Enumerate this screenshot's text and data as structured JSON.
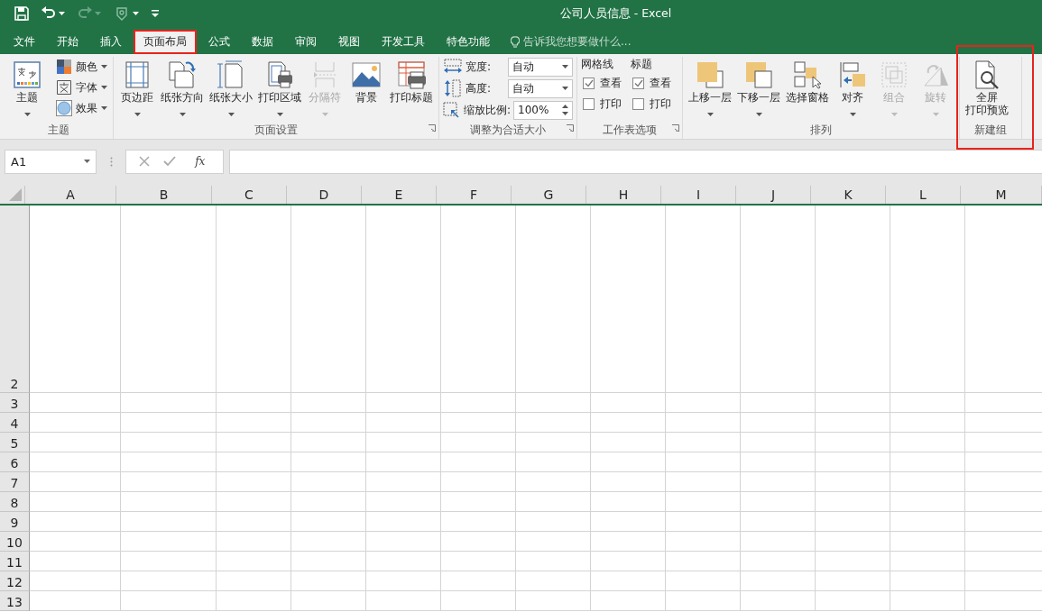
{
  "window": {
    "title": "公司人员信息 - Excel"
  },
  "quick_access": [
    {
      "kind": "save",
      "disabled": false
    },
    {
      "kind": "undo",
      "disabled": false
    },
    {
      "kind": "redo",
      "disabled": true
    },
    {
      "kind": "touch",
      "disabled": false
    },
    {
      "kind": "customize",
      "disabled": false
    }
  ],
  "tabs": [
    {
      "label": "文件",
      "selected": false,
      "highlighted": false
    },
    {
      "label": "开始",
      "selected": false,
      "highlighted": false
    },
    {
      "label": "插入",
      "selected": false,
      "highlighted": false
    },
    {
      "label": "页面布局",
      "selected": true,
      "highlighted": true
    },
    {
      "label": "公式",
      "selected": false,
      "highlighted": false
    },
    {
      "label": "数据",
      "selected": false,
      "highlighted": false
    },
    {
      "label": "审阅",
      "selected": false,
      "highlighted": false
    },
    {
      "label": "视图",
      "selected": false,
      "highlighted": false
    },
    {
      "label": "开发工具",
      "selected": false,
      "highlighted": false
    },
    {
      "label": "特色功能",
      "selected": false,
      "highlighted": false
    }
  ],
  "tell_me": {
    "placeholder": "告诉我您想要做什么..."
  },
  "ribbon": {
    "groups": [
      {
        "label": "主题",
        "launcher": false,
        "highlighted": false,
        "items": [
          {
            "kind": "large",
            "label_lines": [
              "主题"
            ],
            "dropdown": true,
            "disabled": false
          },
          {
            "kind": "stack",
            "items": [
              {
                "label": "颜色",
                "dropdown": true
              },
              {
                "label": "字体",
                "dropdown": true
              },
              {
                "label": "效果",
                "dropdown": true
              }
            ]
          }
        ]
      },
      {
        "label": "页面设置",
        "launcher": true,
        "highlighted": false,
        "items": [
          {
            "kind": "large",
            "label_lines": [
              "页边距"
            ],
            "dropdown": true,
            "disabled": false
          },
          {
            "kind": "large",
            "label_lines": [
              "纸张方向"
            ],
            "dropdown": true,
            "disabled": false
          },
          {
            "kind": "large",
            "label_lines": [
              "纸张大小"
            ],
            "dropdown": true,
            "disabled": false
          },
          {
            "kind": "large",
            "label_lines": [
              "打印区域"
            ],
            "dropdown": true,
            "disabled": false
          },
          {
            "kind": "large",
            "label_lines": [
              "分隔符"
            ],
            "dropdown": true,
            "disabled": true
          },
          {
            "kind": "large",
            "label_lines": [
              "背景"
            ],
            "dropdown": false,
            "disabled": false
          },
          {
            "kind": "large",
            "label_lines": [
              "打印标题"
            ],
            "dropdown": false,
            "disabled": false
          }
        ]
      },
      {
        "label": "调整为合适大小",
        "launcher": true,
        "highlighted": false,
        "items": [
          {
            "kind": "fields",
            "items": [
              {
                "label": "宽度:",
                "value": "自动",
                "kind": "dropdown"
              },
              {
                "label": "高度:",
                "value": "自动",
                "kind": "dropdown"
              },
              {
                "label": "缩放比例:",
                "value": "100%",
                "kind": "spin"
              }
            ]
          }
        ]
      },
      {
        "label": "工作表选项",
        "launcher": true,
        "highlighted": false,
        "items": [
          {
            "kind": "checks",
            "heading": "网格线",
            "items": [
              {
                "label": "查看",
                "checked": true
              },
              {
                "label": "打印",
                "checked": false
              }
            ]
          },
          {
            "kind": "checks",
            "heading": "标题",
            "items": [
              {
                "label": "查看",
                "checked": true
              },
              {
                "label": "打印",
                "checked": false
              }
            ]
          }
        ]
      },
      {
        "label": "排列",
        "launcher": false,
        "highlighted": false,
        "items": [
          {
            "kind": "large",
            "label_lines": [
              "上移一层"
            ],
            "dropdown": true,
            "disabled": false
          },
          {
            "kind": "large",
            "label_lines": [
              "下移一层"
            ],
            "dropdown": true,
            "disabled": false
          },
          {
            "kind": "large",
            "label_lines": [
              "选择窗格"
            ],
            "dropdown": false,
            "disabled": false
          },
          {
            "kind": "large",
            "label_lines": [
              "对齐"
            ],
            "dropdown": true,
            "disabled": false
          },
          {
            "kind": "large",
            "label_lines": [
              "组合"
            ],
            "dropdown": true,
            "disabled": true
          },
          {
            "kind": "large",
            "label_lines": [
              "旋转"
            ],
            "dropdown": true,
            "disabled": true
          }
        ]
      },
      {
        "label": "新建组",
        "launcher": false,
        "highlighted": true,
        "items": [
          {
            "kind": "large",
            "label_lines": [
              "全屏",
              "打印预览"
            ],
            "dropdown": false,
            "disabled": false
          }
        ]
      }
    ]
  },
  "formula_bar": {
    "name_box": "A1",
    "function_label": "fx"
  },
  "sheet": {
    "columns": [
      "A",
      "B",
      "C",
      "D",
      "E",
      "F",
      "G",
      "H",
      "I",
      "J",
      "K",
      "L",
      "M"
    ],
    "rows": [
      "2",
      "3",
      "4",
      "5",
      "6",
      "7",
      "8",
      "9",
      "10",
      "11",
      "12",
      "13"
    ]
  }
}
